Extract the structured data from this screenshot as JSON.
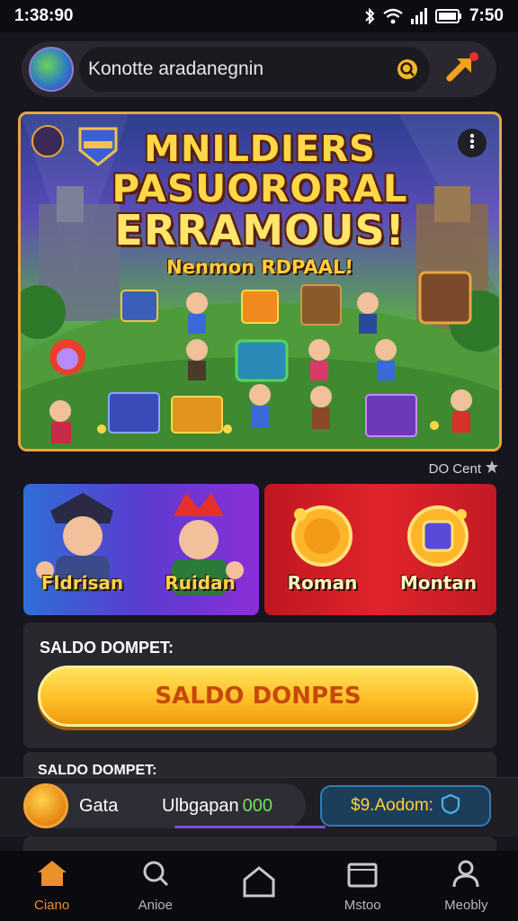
{
  "status_bar": {
    "time": "1:38:90",
    "clock": "7:50"
  },
  "header": {
    "search_text": "Konotte aradanegnin"
  },
  "banner": {
    "title_line1": "MNILDIERS",
    "title_line2": "PASUORORAL",
    "title_line3": "ERRAMOUS!",
    "subtitle": "Nenmon RDPAAL!"
  },
  "credit": "DO Cent",
  "cards": [
    {
      "label": "Fldrisan"
    },
    {
      "label": "Ruidan"
    },
    {
      "label": "Roman"
    },
    {
      "label": "Montan"
    }
  ],
  "wallet": {
    "label": "SALDO DOMPET:",
    "button": "SALDO DONPES",
    "label2": "SALDO DOMPET:"
  },
  "balance": {
    "coin_label": "Gata",
    "balance_label": "Ulbgapan",
    "balance_value": "000",
    "money": "$9.Aodom:"
  },
  "nav": [
    {
      "label": "Ciano"
    },
    {
      "label": "Anioe"
    },
    {
      "label": ""
    },
    {
      "label": "Mstoo"
    },
    {
      "label": "Meobly"
    }
  ],
  "colors": {
    "accent": "#e8912b",
    "gold": "#ffbf27",
    "banner_border": "#e6a640",
    "balance_green": "#6fe35a"
  }
}
